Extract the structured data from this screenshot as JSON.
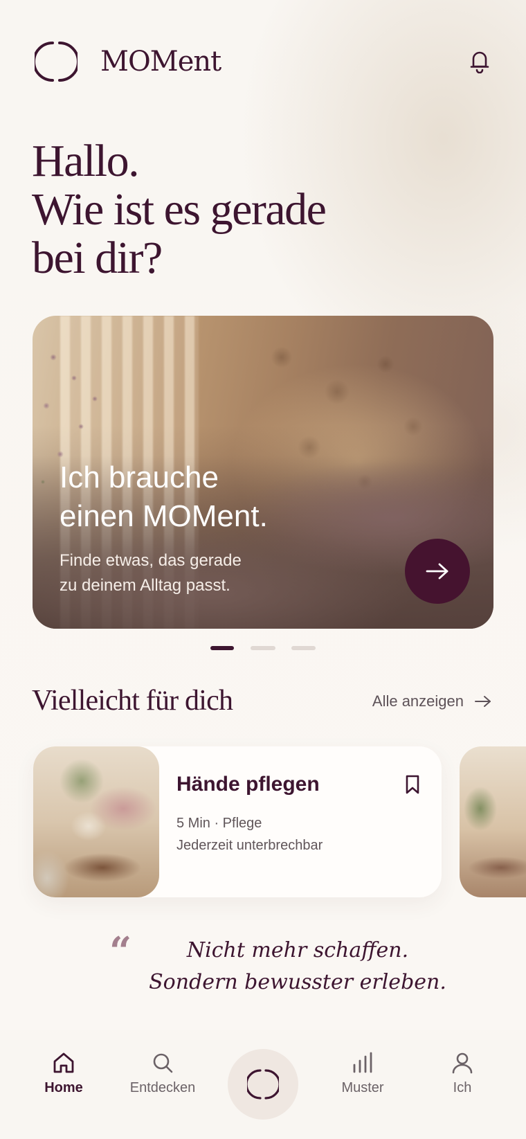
{
  "header": {
    "app_name": "MOMent",
    "logo_icon": "circle-brackets-icon",
    "notification_icon": "bell-icon"
  },
  "greeting": {
    "lines": [
      "Hallo.",
      "Wie ist es gerade",
      "bei dir?"
    ]
  },
  "hero": {
    "title_lines": [
      "Ich brauche",
      "einen MOMent."
    ],
    "subtitle_lines": [
      "Finde etwas, das gerade",
      "zu deinem Alltag passt."
    ],
    "action_icon": "arrow-right-icon",
    "carousel": {
      "count": 3,
      "active_index": 0
    }
  },
  "recommendations": {
    "title": "Vielleicht für dich",
    "see_all_label": "Alle anzeigen",
    "items": [
      {
        "title": "Hände pflegen",
        "meta": "5 Min · Pflege",
        "note": "Jederzeit unterbrechbar",
        "bookmark_icon": "bookmark-icon"
      }
    ]
  },
  "quote": {
    "mark": "“",
    "lines": [
      "Nicht mehr schaffen.",
      "Sondern bewusster erleben."
    ]
  },
  "nav": {
    "items": [
      {
        "label": "Home",
        "icon": "home-icon",
        "active": true
      },
      {
        "label": "Entdecken",
        "icon": "search-icon",
        "active": false
      },
      {
        "label": "",
        "icon": "circle-brackets-icon",
        "active": false
      },
      {
        "label": "Muster",
        "icon": "bar-chart-icon",
        "active": false
      },
      {
        "label": "Ich",
        "icon": "user-icon",
        "active": false
      }
    ]
  },
  "colors": {
    "primary": "#3d1530",
    "accent_button": "#45132f",
    "background": "#f8f5f1",
    "inactive_dot": "#e0d8d3"
  }
}
